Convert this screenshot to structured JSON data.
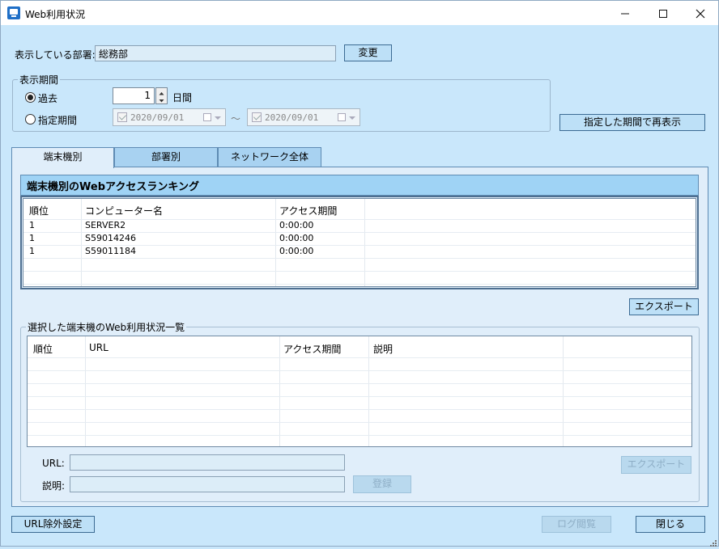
{
  "window": {
    "title": "Web利用状況",
    "minimize_icon": "minimize-icon",
    "maximize_icon": "maximize-icon",
    "close_icon": "close-icon"
  },
  "department": {
    "label": "表示している部署:",
    "value": "総務部",
    "change_button": "変更"
  },
  "period": {
    "legend": "表示期間",
    "past_label": "過去",
    "past_value": "1",
    "past_unit": "日間",
    "specified_label": "指定期間",
    "selected": "past",
    "from_date": "2020/09/01",
    "to_date": "2020/09/01",
    "range_separator": "～",
    "redisplay_button": "指定した期間で再表示"
  },
  "tabs": [
    {
      "label": "端末機別",
      "active": true
    },
    {
      "label": "部署別",
      "active": false
    },
    {
      "label": "ネットワーク全体",
      "active": false
    }
  ],
  "ranking": {
    "title": "端末機別のWebアクセスランキング",
    "columns": [
      "順位",
      "コンピューター名",
      "アクセス期間"
    ],
    "rows": [
      {
        "rank": "1",
        "computer": "SERVER2",
        "duration": "0:00:00"
      },
      {
        "rank": "1",
        "computer": "S59014246",
        "duration": "0:00:00"
      },
      {
        "rank": "1",
        "computer": "S59011184",
        "duration": "0:00:00"
      }
    ],
    "export_button": "エクスポート"
  },
  "detail": {
    "legend": "選択した端末機のWeb利用状況一覧",
    "columns": [
      "順位",
      "URL",
      "アクセス期間",
      "説明"
    ],
    "url_label": "URL:",
    "url_value": "",
    "desc_label": "説明:",
    "desc_value": "",
    "register_button": "登録",
    "export_button": "エクスポート"
  },
  "footer": {
    "url_exclusion_button": "URL除外設定",
    "log_view_button": "ログ閲覧",
    "close_button": "閉じる"
  },
  "colors": {
    "window_bg": "#c9e7fb",
    "panel_bg": "#e0eefa",
    "header_bg": "#9fd3f5",
    "button_bg": "#bde0f7",
    "border": "#5e8bb3"
  }
}
